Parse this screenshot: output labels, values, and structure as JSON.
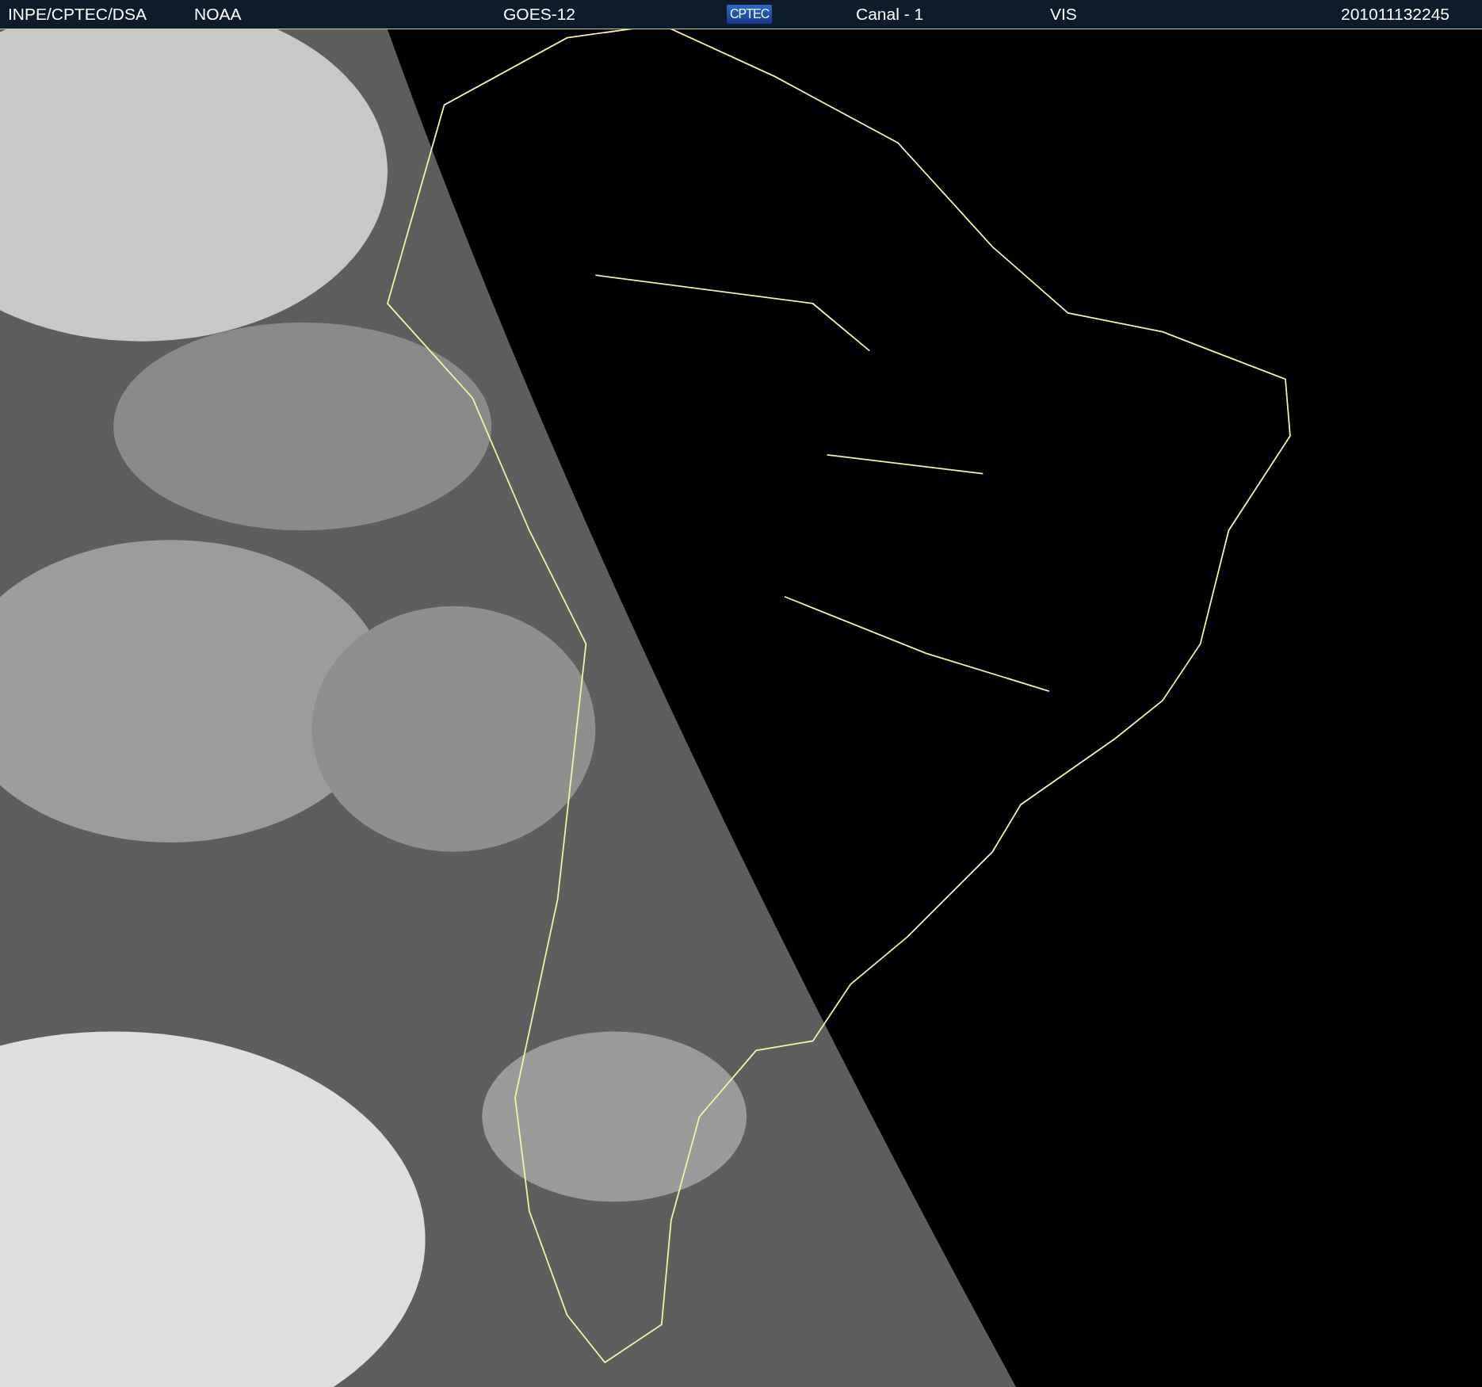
{
  "header": {
    "items": [
      {
        "kind": "text",
        "text": "INPE/CPTEC/DSA"
      },
      {
        "kind": "text",
        "text": "NOAA"
      },
      {
        "kind": "text",
        "text": "GOES-12"
      },
      {
        "kind": "logo",
        "text": "CPTEC"
      },
      {
        "kind": "text",
        "text": "Canal - 1"
      },
      {
        "kind": "text",
        "text": "VIS"
      },
      {
        "kind": "text",
        "text": "201011132245"
      }
    ]
  }
}
